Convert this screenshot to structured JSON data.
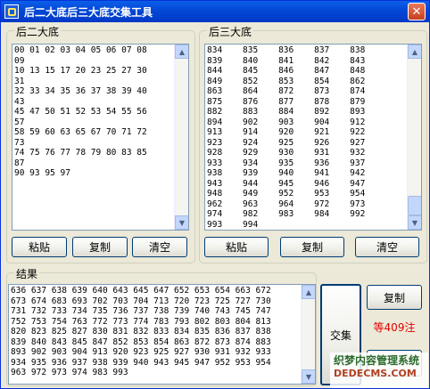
{
  "window": {
    "title": "后二大底后三大底交集工具",
    "close_glyph": "✕"
  },
  "icons": {
    "app": "app-icon",
    "close": "close-icon",
    "scroll_up": "arrow-up-icon",
    "scroll_down": "arrow-down-icon"
  },
  "panel_two": {
    "label": "后二大底",
    "text": "00 01 02 03 04 05 06 07 08\n09\n10 13 15 17 20 23 25 27 30\n31\n32 33 34 35 36 37 38 39 40\n43\n45 47 50 51 52 53 54 55 56\n57\n58 59 60 63 65 67 70 71 72\n73\n74 75 76 77 78 79 80 83 85\n87\n90 93 95 97",
    "paste": "粘贴",
    "copy": "复制",
    "clear": "清空"
  },
  "panel_three": {
    "label": "后三大底",
    "text": "834    835    836    837    838\n839    840    841    842    843\n844    845    846    847    848\n849    852    853    854    862\n863    864    872    873    874\n875    876    877    878    879\n882    883    884    892    893\n894    902    903    904    912\n913    914    920    921    922\n923    924    925    926    927\n928    929    930    931    932\n933    934    935    936    937\n938    939    940    941    942\n943    944    945    946    947\n948    949    952    953    954\n962    963    964    972    973\n974    982    983    984    992\n993    994",
    "paste": "粘贴",
    "copy": "复制",
    "clear": "清空"
  },
  "result": {
    "label": "结果",
    "text": "636 637 638 639 640 643 645 647 652 653 654 663 672\n673 674 683 693 702 703 704 713 720 723 725 727 730\n731 732 733 734 735 736 737 738 739 740 743 745 747\n752 753 754 763 772 773 774 783 793 802 803 804 813\n820 823 825 827 830 831 832 833 834 835 836 837 838\n839 840 843 845 847 852 853 854 863 872 873 874 883\n893 902 903 904 913 920 923 925 927 930 931 932 933\n934 935 936 937 938 939 940 943 945 947 952 953 954\n963 972 973 974 983 993",
    "intersect": "交集",
    "copy": "复制",
    "count": "等409注"
  },
  "watermark": {
    "line1": "织梦内容管理系统",
    "line2": "DEDECMS.COM"
  },
  "colors": {
    "count_text": "#e00000",
    "title_bar": "#0347d6"
  }
}
